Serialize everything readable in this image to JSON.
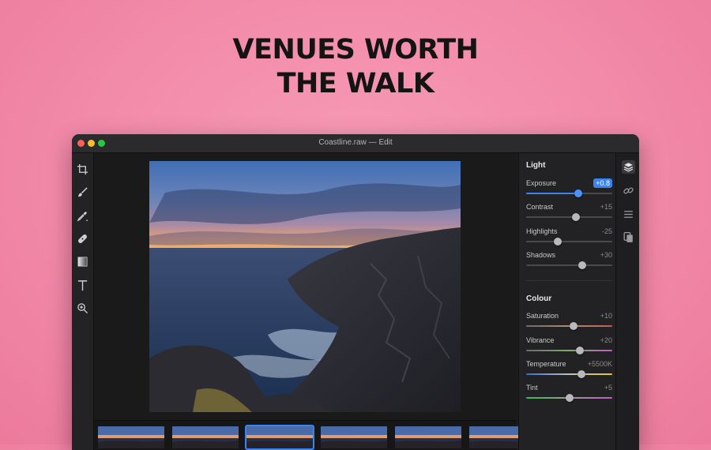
{
  "headline": {
    "line1": "VENUES WORTH",
    "line2": "THE WALK"
  },
  "window": {
    "title": "Coastline.raw — Edit",
    "traffic_lights": [
      "#fe5f57",
      "#febc2e",
      "#28c840"
    ]
  },
  "toolbar": {
    "tools": [
      {
        "name": "crop-icon"
      },
      {
        "name": "brush-icon"
      },
      {
        "name": "eyedropper-icon"
      },
      {
        "name": "healing-icon"
      },
      {
        "name": "gradient-icon"
      },
      {
        "name": "text-icon"
      },
      {
        "name": "zoom-icon"
      }
    ]
  },
  "panel": {
    "light": {
      "title": "Light",
      "sliders": [
        {
          "label": "Exposure",
          "value": "+0.8",
          "level": 0.61,
          "active": true
        },
        {
          "label": "Contrast",
          "value": "+15",
          "level": 0.58
        },
        {
          "label": "Highlights",
          "value": "-25",
          "level": 0.37
        },
        {
          "label": "Shadows",
          "value": "+30",
          "level": 0.65
        }
      ]
    },
    "colour": {
      "title": "Colour",
      "sliders": [
        {
          "label": "Saturation",
          "value": "+10",
          "level": 0.55,
          "gradient": "sat"
        },
        {
          "label": "Vibrance",
          "value": "+20",
          "level": 0.62,
          "gradient": "vib"
        },
        {
          "label": "Temperature",
          "value": "+5500K",
          "level": 0.64,
          "gradient": "temp"
        },
        {
          "label": "Tint",
          "value": "+5",
          "level": 0.5,
          "gradient": "tint"
        }
      ]
    }
  },
  "rail": {
    "buttons": [
      {
        "name": "layers-icon",
        "active": true
      },
      {
        "name": "link-icon",
        "active": false
      },
      {
        "name": "list-icon",
        "active": false
      },
      {
        "name": "copy-settings-icon",
        "active": false
      }
    ]
  },
  "colors": {
    "accent": "#3a84f0",
    "background": "#f28aa9",
    "window": "#1c1c1e"
  },
  "filmstrip": {
    "count": 6,
    "selected_index": 2
  }
}
